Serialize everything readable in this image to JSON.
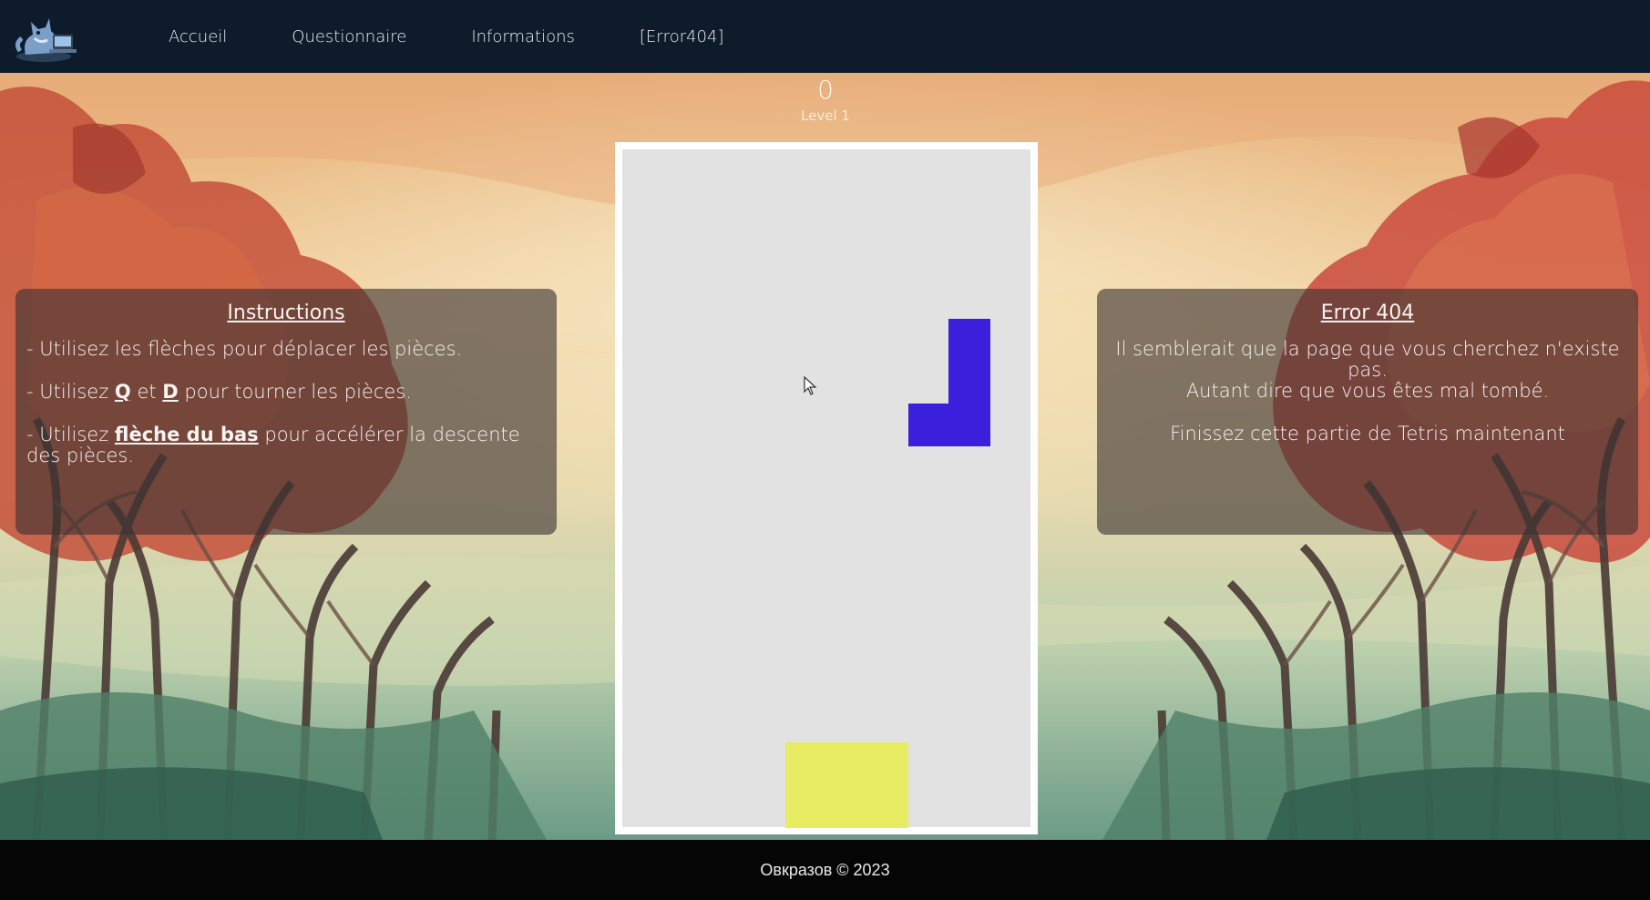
{
  "nav": {
    "logo_icon": "fox-on-laptop-logo",
    "items": [
      {
        "label": "Accueil"
      },
      {
        "label": "Questionnaire"
      },
      {
        "label": "Informations"
      },
      {
        "label": "[Error404]"
      }
    ]
  },
  "game": {
    "score": "0",
    "level": "Level 1",
    "board": {
      "cols": 10,
      "rows": 16
    },
    "active_piece": {
      "type": "J",
      "color": "#3a1fdc",
      "cells": [
        [
          8,
          4
        ],
        [
          8,
          5
        ],
        [
          8,
          6
        ],
        [
          7,
          6
        ]
      ]
    },
    "landed_piece": {
      "type": "O",
      "color": "#e8ec62",
      "cells": [
        [
          4,
          14
        ],
        [
          5,
          14
        ],
        [
          6,
          14
        ],
        [
          4,
          15
        ],
        [
          5,
          15
        ],
        [
          6,
          15
        ]
      ]
    }
  },
  "instructions": {
    "title": "Instructions",
    "line1": "- Utilisez les flèches pour déplacer les pièces.",
    "line2_pre": "- Utilisez ",
    "line2_key1": "Q",
    "line2_mid": " et ",
    "line2_key2": "D",
    "line2_post": " pour tourner les pièces.",
    "line3_pre": "- Utilisez ",
    "line3_key": "flèche du bas",
    "line3_post": " pour accélérer la descente des pièces."
  },
  "error": {
    "title": "Error 404",
    "line1": "Il semblerait que la page que vous cherchez n'existe pas.",
    "line2": "Autant dire que vous êtes mal tombé.",
    "line3": "Finissez cette partie de Tetris maintenant"
  },
  "footer": {
    "text": "Овкразов © 2023"
  }
}
